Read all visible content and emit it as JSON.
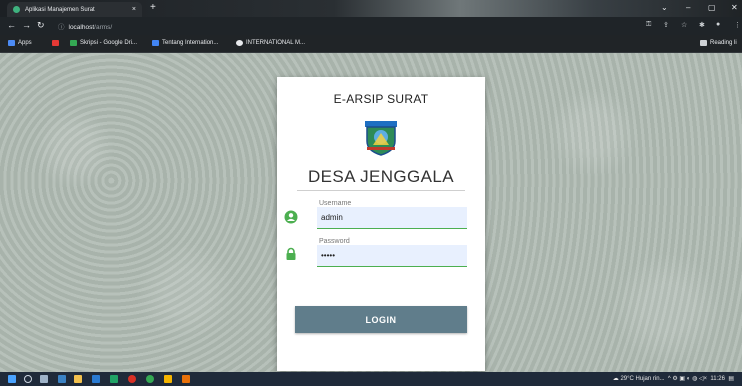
{
  "browser": {
    "tab_title": "Aplikasi Manajemen Surat",
    "tab_close": "×",
    "new_tab": "+",
    "url_host": "localhost",
    "url_path": "/arms/",
    "bookmarks": [
      {
        "label": "Apps",
        "color": "#4c8bf5"
      },
      {
        "label": "",
        "color": "#e53935"
      },
      {
        "label": "Skripsi - Google Dri...",
        "color": "#34a853"
      },
      {
        "label": "Tentang Internation...",
        "color": "#4285f4"
      },
      {
        "label": "INTERNATIONAL M...",
        "color": "#e8eaed"
      }
    ],
    "reading_list": "Reading li"
  },
  "login": {
    "header": "E-ARSIP SURAT",
    "village": "DESA JENGGALA",
    "username_label": "Username",
    "username_value": "admin",
    "password_label": "Password",
    "password_value": "•••••",
    "button": "LOGIN"
  },
  "taskbar": {
    "weather": "29°C  Hujan rin...",
    "time": "11:26"
  },
  "colors": {
    "accent": "#607d8b",
    "input_bg": "#e8f0fe",
    "input_line": "#4caf50",
    "icon_green": "#4caf50"
  }
}
